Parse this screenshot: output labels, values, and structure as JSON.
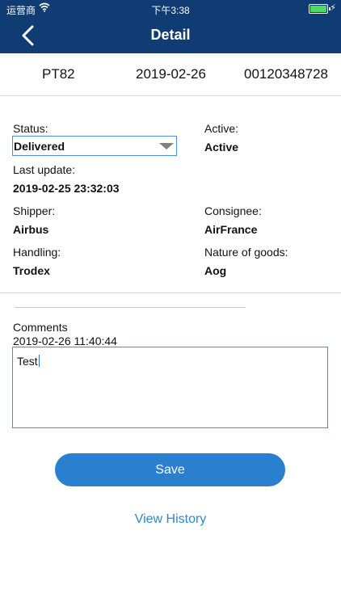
{
  "statusbar": {
    "carrier": "运营商",
    "time": "下午3:38"
  },
  "navbar": {
    "title": "Detail"
  },
  "summary": {
    "code": "PT82",
    "date": "2019-02-26",
    "number": "00120348728"
  },
  "details": {
    "status_label": "Status:",
    "status_value": "Delivered",
    "active_label": "Active:",
    "active_value": "Active",
    "last_update_label": "Last update:",
    "last_update_value": "2019-02-25 23:32:03",
    "shipper_label": "Shipper:",
    "shipper_value": "Airbus",
    "consignee_label": "Consignee:",
    "consignee_value": "AirFrance",
    "handling_label": "Handling:",
    "handling_value": "Trodex",
    "nature_label": "Nature of goods:",
    "nature_value": "Aog"
  },
  "comments": {
    "label": "Comments",
    "timestamp": "2019-02-26 11:40:44",
    "value": "Test"
  },
  "actions": {
    "save_label": "Save",
    "history_label": "View History"
  },
  "colors": {
    "header": "#0f3c73",
    "accent": "#2b7fcf",
    "link": "#2f86cc",
    "battery": "#4cd964"
  }
}
